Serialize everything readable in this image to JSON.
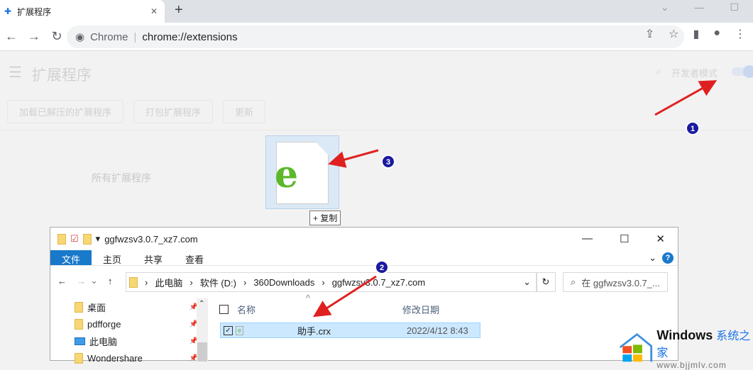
{
  "browser": {
    "tab_title": "扩展程序",
    "new_tab": "+",
    "omnibox_site": "Chrome",
    "omnibox_url": "chrome://extensions"
  },
  "extensions": {
    "title": "扩展程序",
    "dev_mode": "开发者模式",
    "dev_mode_on": true,
    "buttons": [
      "加载已解压的扩展程序",
      "打包扩展程序",
      "更新"
    ],
    "all_label": "所有扩展程序"
  },
  "drag": {
    "copy_label": "+ 复制"
  },
  "explorer": {
    "title": "ggfwzsv3.0.7_xz7.com",
    "ribbon": [
      "文件",
      "主页",
      "共享",
      "查看"
    ],
    "path": [
      "此电脑",
      "软件 (D:)",
      "360Downloads",
      "ggfwzsv3.0.7_xz7.com"
    ],
    "search_placeholder": "在 ggfwzsv3.0.7_...",
    "nav": [
      "桌面",
      "pdfforge",
      "此电脑",
      "Wondershare"
    ],
    "columns": [
      "名称",
      "修改日期"
    ],
    "files": [
      {
        "name": "助手.crx",
        "date": "2022/4/12 8:43",
        "selected": true
      }
    ]
  },
  "annotations": {
    "markers": [
      "1",
      "2",
      "3"
    ],
    "arrow_color": "#e02020"
  },
  "watermark": {
    "brand": "Windows",
    "brand_cn": "系统之家",
    "url": "www.bjjmlv.com"
  }
}
